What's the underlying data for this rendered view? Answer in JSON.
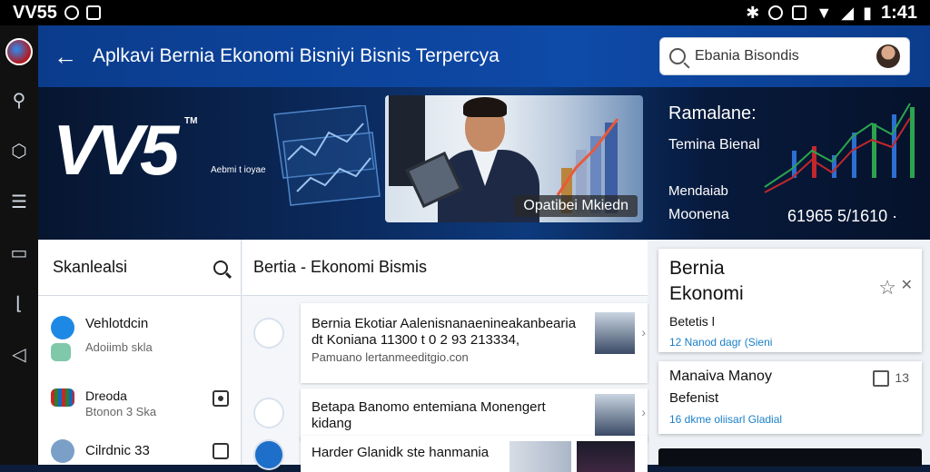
{
  "status_bar": {
    "brand": "VV55",
    "time": "1:41"
  },
  "app_bar": {
    "title": "Aplkavi Bernia Ekonomi Bisniyi Bisnis Terpercya",
    "search_value": "Ebania Bisondis"
  },
  "banner": {
    "brand": "VV5",
    "tm": "TM",
    "brand_subtitle": "Aebmi t ioyae",
    "photo_caption": "Opatibei Mkiedn",
    "facts": {
      "heading": "Ramalane:",
      "line1": "Temina Bienal",
      "line2": "Mendaiab",
      "line3": "Moonena",
      "number": "61965 5/1610 ·"
    }
  },
  "panel_left": {
    "title": "Skanlealsi",
    "items": [
      {
        "title": "Vehlotdcin",
        "subtitle": "Adoiimb skla"
      },
      {
        "title": "Dreoda",
        "subtitle": "Btonon 3 Ska"
      },
      {
        "title": "Cilrdnic 33",
        "subtitle": ""
      }
    ]
  },
  "panel_center": {
    "title": "Bertia - Ekonomi Bismis",
    "rows": [
      {
        "title": "Bernia Ekotiar Aalenisnanaenineakanbearia",
        "line2": "dt Koniana 11300 t 0 2 93 213334,",
        "subtitle": "Pamuano lertanmeeditgio.con"
      },
      {
        "title": "Betapa Banomo entemiana Monengert kidang",
        "stars": "★★★★★★★★★★★★★★"
      },
      {
        "title": "Harder Glanidk ste hanmania",
        "subtitle": ""
      }
    ]
  },
  "panel_right": {
    "cards": [
      {
        "title_l1": "Bernia",
        "title_l2": "Ekonomi",
        "subtitle": "Betetis l",
        "link": "12 Nanod dagr (Sieni"
      },
      {
        "title": "Manaiva Manoy",
        "subtitle": "Befenist",
        "link": "16 dkme oliisarl Gladial",
        "count": "13"
      }
    ]
  },
  "colors": {
    "appbar": "#0e4aa8",
    "banner_dark": "#07152f",
    "link": "#1a7fc6",
    "stars": "#f0b400"
  }
}
